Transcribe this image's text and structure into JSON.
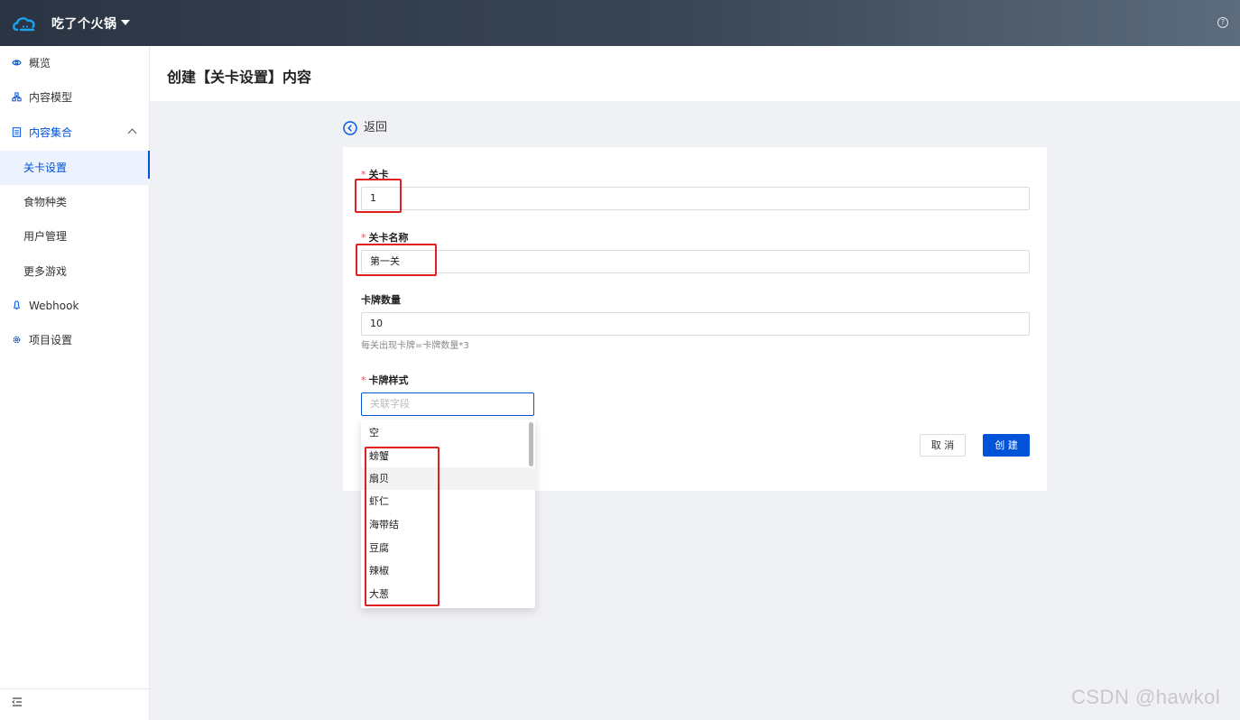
{
  "app": {
    "name": "吃了个火锅"
  },
  "sidebar": {
    "items": [
      {
        "label": "概览",
        "icon": "eye-icon"
      },
      {
        "label": "内容模型",
        "icon": "model-icon"
      },
      {
        "label": "内容集合",
        "icon": "collection-icon",
        "expanded": true
      },
      {
        "label": "关卡设置",
        "active": true
      },
      {
        "label": "食物种类"
      },
      {
        "label": "用户管理"
      },
      {
        "label": "更多游戏"
      },
      {
        "label": "Webhook",
        "icon": "webhook-icon"
      },
      {
        "label": "项目设置",
        "icon": "gear-icon"
      }
    ]
  },
  "page": {
    "title": "创建【关卡设置】内容",
    "back_label": "返回"
  },
  "form": {
    "level": {
      "label": "关卡",
      "required": "*",
      "value": "1"
    },
    "level_name": {
      "label": "关卡名称",
      "required": "*",
      "value": "第一关"
    },
    "card_count": {
      "label": "卡牌数量",
      "value": "10",
      "help": "每关出现卡牌=卡牌数量*3"
    },
    "card_style": {
      "label": "卡牌样式",
      "required": "*",
      "placeholder": "关联字段"
    },
    "cancel_label": "取 消",
    "create_label": "创 建"
  },
  "dropdown": {
    "options": [
      "空",
      "螃蟹",
      "扇贝",
      "虾仁",
      "海带结",
      "豆腐",
      "辣椒",
      "大葱"
    ],
    "hover_index": 2
  },
  "watermark": "CSDN @hawkol",
  "colors": {
    "primary": "#0052d9",
    "highlight": "#e02020",
    "required": "#e34d59"
  }
}
